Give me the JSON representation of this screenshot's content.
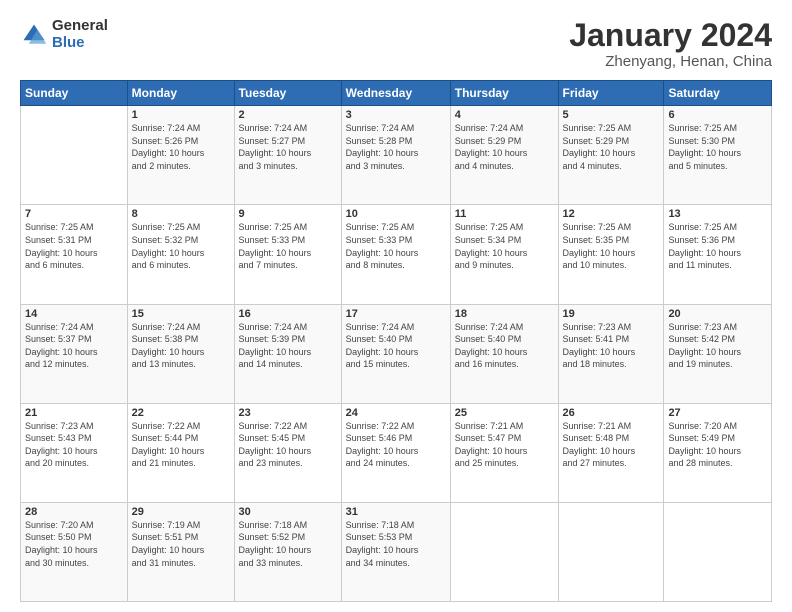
{
  "logo": {
    "general": "General",
    "blue": "Blue"
  },
  "title": "January 2024",
  "subtitle": "Zhenyang, Henan, China",
  "headers": [
    "Sunday",
    "Monday",
    "Tuesday",
    "Wednesday",
    "Thursday",
    "Friday",
    "Saturday"
  ],
  "weeks": [
    [
      {
        "day": "",
        "info": ""
      },
      {
        "day": "1",
        "info": "Sunrise: 7:24 AM\nSunset: 5:26 PM\nDaylight: 10 hours\nand 2 minutes."
      },
      {
        "day": "2",
        "info": "Sunrise: 7:24 AM\nSunset: 5:27 PM\nDaylight: 10 hours\nand 3 minutes."
      },
      {
        "day": "3",
        "info": "Sunrise: 7:24 AM\nSunset: 5:28 PM\nDaylight: 10 hours\nand 3 minutes."
      },
      {
        "day": "4",
        "info": "Sunrise: 7:24 AM\nSunset: 5:29 PM\nDaylight: 10 hours\nand 4 minutes."
      },
      {
        "day": "5",
        "info": "Sunrise: 7:25 AM\nSunset: 5:29 PM\nDaylight: 10 hours\nand 4 minutes."
      },
      {
        "day": "6",
        "info": "Sunrise: 7:25 AM\nSunset: 5:30 PM\nDaylight: 10 hours\nand 5 minutes."
      }
    ],
    [
      {
        "day": "7",
        "info": "Sunrise: 7:25 AM\nSunset: 5:31 PM\nDaylight: 10 hours\nand 6 minutes."
      },
      {
        "day": "8",
        "info": "Sunrise: 7:25 AM\nSunset: 5:32 PM\nDaylight: 10 hours\nand 6 minutes."
      },
      {
        "day": "9",
        "info": "Sunrise: 7:25 AM\nSunset: 5:33 PM\nDaylight: 10 hours\nand 7 minutes."
      },
      {
        "day": "10",
        "info": "Sunrise: 7:25 AM\nSunset: 5:33 PM\nDaylight: 10 hours\nand 8 minutes."
      },
      {
        "day": "11",
        "info": "Sunrise: 7:25 AM\nSunset: 5:34 PM\nDaylight: 10 hours\nand 9 minutes."
      },
      {
        "day": "12",
        "info": "Sunrise: 7:25 AM\nSunset: 5:35 PM\nDaylight: 10 hours\nand 10 minutes."
      },
      {
        "day": "13",
        "info": "Sunrise: 7:25 AM\nSunset: 5:36 PM\nDaylight: 10 hours\nand 11 minutes."
      }
    ],
    [
      {
        "day": "14",
        "info": "Sunrise: 7:24 AM\nSunset: 5:37 PM\nDaylight: 10 hours\nand 12 minutes."
      },
      {
        "day": "15",
        "info": "Sunrise: 7:24 AM\nSunset: 5:38 PM\nDaylight: 10 hours\nand 13 minutes."
      },
      {
        "day": "16",
        "info": "Sunrise: 7:24 AM\nSunset: 5:39 PM\nDaylight: 10 hours\nand 14 minutes."
      },
      {
        "day": "17",
        "info": "Sunrise: 7:24 AM\nSunset: 5:40 PM\nDaylight: 10 hours\nand 15 minutes."
      },
      {
        "day": "18",
        "info": "Sunrise: 7:24 AM\nSunset: 5:40 PM\nDaylight: 10 hours\nand 16 minutes."
      },
      {
        "day": "19",
        "info": "Sunrise: 7:23 AM\nSunset: 5:41 PM\nDaylight: 10 hours\nand 18 minutes."
      },
      {
        "day": "20",
        "info": "Sunrise: 7:23 AM\nSunset: 5:42 PM\nDaylight: 10 hours\nand 19 minutes."
      }
    ],
    [
      {
        "day": "21",
        "info": "Sunrise: 7:23 AM\nSunset: 5:43 PM\nDaylight: 10 hours\nand 20 minutes."
      },
      {
        "day": "22",
        "info": "Sunrise: 7:22 AM\nSunset: 5:44 PM\nDaylight: 10 hours\nand 21 minutes."
      },
      {
        "day": "23",
        "info": "Sunrise: 7:22 AM\nSunset: 5:45 PM\nDaylight: 10 hours\nand 23 minutes."
      },
      {
        "day": "24",
        "info": "Sunrise: 7:22 AM\nSunset: 5:46 PM\nDaylight: 10 hours\nand 24 minutes."
      },
      {
        "day": "25",
        "info": "Sunrise: 7:21 AM\nSunset: 5:47 PM\nDaylight: 10 hours\nand 25 minutes."
      },
      {
        "day": "26",
        "info": "Sunrise: 7:21 AM\nSunset: 5:48 PM\nDaylight: 10 hours\nand 27 minutes."
      },
      {
        "day": "27",
        "info": "Sunrise: 7:20 AM\nSunset: 5:49 PM\nDaylight: 10 hours\nand 28 minutes."
      }
    ],
    [
      {
        "day": "28",
        "info": "Sunrise: 7:20 AM\nSunset: 5:50 PM\nDaylight: 10 hours\nand 30 minutes."
      },
      {
        "day": "29",
        "info": "Sunrise: 7:19 AM\nSunset: 5:51 PM\nDaylight: 10 hours\nand 31 minutes."
      },
      {
        "day": "30",
        "info": "Sunrise: 7:18 AM\nSunset: 5:52 PM\nDaylight: 10 hours\nand 33 minutes."
      },
      {
        "day": "31",
        "info": "Sunrise: 7:18 AM\nSunset: 5:53 PM\nDaylight: 10 hours\nand 34 minutes."
      },
      {
        "day": "",
        "info": ""
      },
      {
        "day": "",
        "info": ""
      },
      {
        "day": "",
        "info": ""
      }
    ]
  ]
}
